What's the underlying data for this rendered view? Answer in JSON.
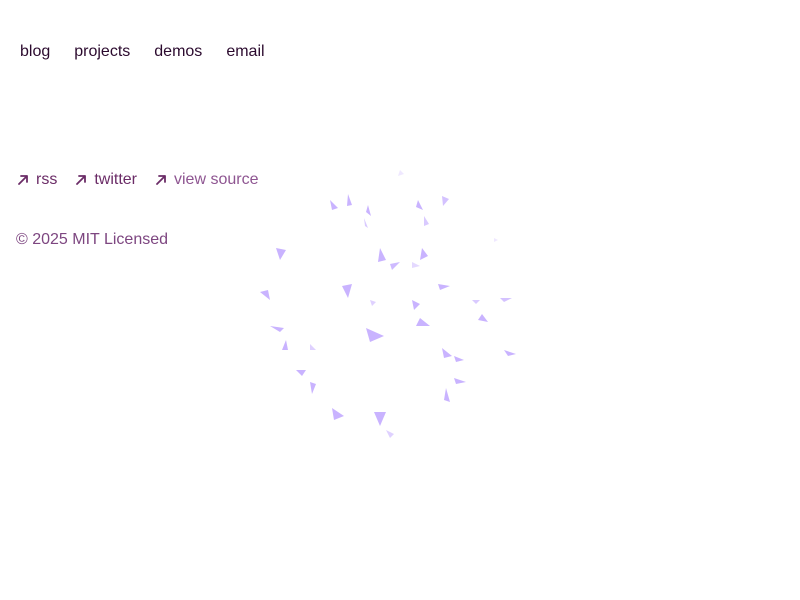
{
  "nav": {
    "items": [
      {
        "label": "blog"
      },
      {
        "label": "projects"
      },
      {
        "label": "demos"
      },
      {
        "label": "email"
      }
    ]
  },
  "footer_links": {
    "items": [
      {
        "label": "rss",
        "icon": "arrow-up-right-icon"
      },
      {
        "label": "twitter",
        "icon": "arrow-up-right-icon"
      },
      {
        "label": "view source",
        "icon": "arrow-up-right-icon"
      }
    ]
  },
  "copyright": {
    "text": "© 2025 MIT Licensed"
  },
  "colors": {
    "nav_text": "#2b0a2e",
    "link_text": "#6b2c67",
    "link_text_light": "#8e5591",
    "particle": "#c9b3ff"
  }
}
